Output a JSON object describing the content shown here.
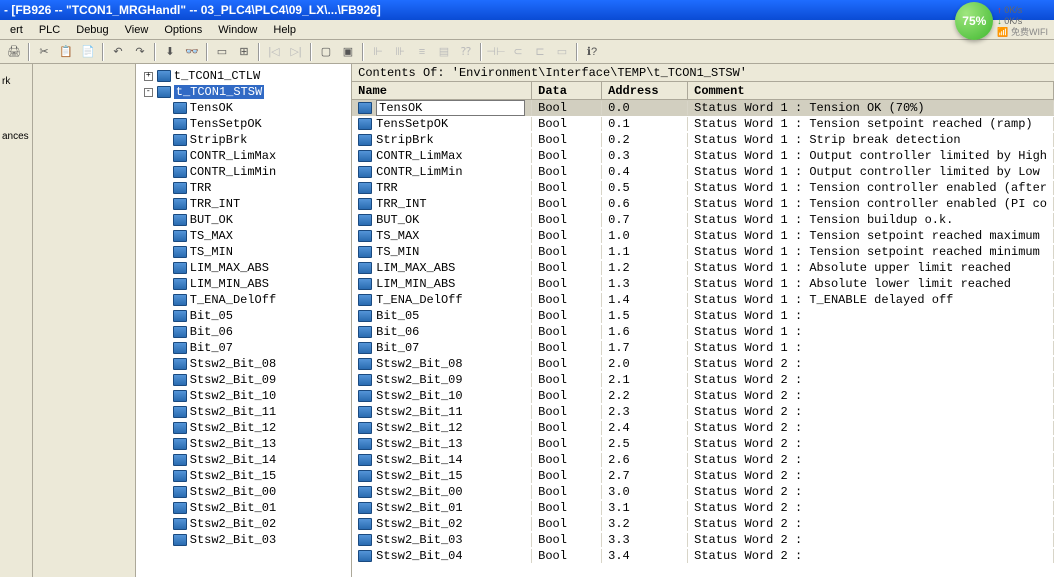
{
  "title": "- [FB926 -- \"TCON1_MRGHandl\" -- 03_PLC4\\PLC4\\09_LX\\...\\FB926]",
  "menu": {
    "items": [
      "ert",
      "PLC",
      "Debug",
      "View",
      "Options",
      "Window",
      "Help"
    ]
  },
  "speed": {
    "pct": "75%",
    "up": "0K/s",
    "down": "0K/s",
    "wifi": "免费WIFI"
  },
  "sidebar": {
    "label1": "rk",
    "label2": "ances"
  },
  "contentsOf": "Contents Of: 'Environment\\Interface\\TEMP\\t_TCON1_STSW'",
  "headers": {
    "name": "Name",
    "type": "Data Type",
    "addr": "Address",
    "comment": "Comment"
  },
  "tree": [
    {
      "label": "t_TCON1_CTLW",
      "indent": 0,
      "box": "+"
    },
    {
      "label": "t_TCON1_STSW",
      "indent": 0,
      "box": "-",
      "sel": true
    },
    {
      "label": "TensOK",
      "indent": 1
    },
    {
      "label": "TensSetpOK",
      "indent": 1
    },
    {
      "label": "StripBrk",
      "indent": 1
    },
    {
      "label": "CONTR_LimMax",
      "indent": 1
    },
    {
      "label": "CONTR_LimMin",
      "indent": 1
    },
    {
      "label": "TRR",
      "indent": 1
    },
    {
      "label": "TRR_INT",
      "indent": 1
    },
    {
      "label": "BUT_OK",
      "indent": 1
    },
    {
      "label": "TS_MAX",
      "indent": 1
    },
    {
      "label": "TS_MIN",
      "indent": 1
    },
    {
      "label": "LIM_MAX_ABS",
      "indent": 1
    },
    {
      "label": "LIM_MIN_ABS",
      "indent": 1
    },
    {
      "label": "T_ENA_DelOff",
      "indent": 1
    },
    {
      "label": "Bit_05",
      "indent": 1
    },
    {
      "label": "Bit_06",
      "indent": 1
    },
    {
      "label": "Bit_07",
      "indent": 1
    },
    {
      "label": "Stsw2_Bit_08",
      "indent": 1
    },
    {
      "label": "Stsw2_Bit_09",
      "indent": 1
    },
    {
      "label": "Stsw2_Bit_10",
      "indent": 1
    },
    {
      "label": "Stsw2_Bit_11",
      "indent": 1
    },
    {
      "label": "Stsw2_Bit_12",
      "indent": 1
    },
    {
      "label": "Stsw2_Bit_13",
      "indent": 1
    },
    {
      "label": "Stsw2_Bit_14",
      "indent": 1
    },
    {
      "label": "Stsw2_Bit_15",
      "indent": 1
    },
    {
      "label": "Stsw2_Bit_00",
      "indent": 1
    },
    {
      "label": "Stsw2_Bit_01",
      "indent": 1
    },
    {
      "label": "Stsw2_Bit_02",
      "indent": 1
    },
    {
      "label": "Stsw2_Bit_03",
      "indent": 1
    }
  ],
  "rows": [
    {
      "name": "TensOK",
      "type": "Bool",
      "addr": "0.0",
      "comment": "Status Word 1 : Tension OK (70%)",
      "sel": true
    },
    {
      "name": "TensSetpOK",
      "type": "Bool",
      "addr": "0.1",
      "comment": "Status Word 1 : Tension setpoint reached (ramp)"
    },
    {
      "name": "StripBrk",
      "type": "Bool",
      "addr": "0.2",
      "comment": "Status Word 1 : Strip break detection"
    },
    {
      "name": "CONTR_LimMax",
      "type": "Bool",
      "addr": "0.3",
      "comment": "Status Word 1 : Output controller limited by High"
    },
    {
      "name": "CONTR_LimMin",
      "type": "Bool",
      "addr": "0.4",
      "comment": "Status Word 1 : Output controller limited by Low"
    },
    {
      "name": "TRR",
      "type": "Bool",
      "addr": "0.5",
      "comment": "Status Word 1 : Tension controller enabled (after"
    },
    {
      "name": "TRR_INT",
      "type": "Bool",
      "addr": "0.6",
      "comment": "Status Word 1 : Tension controller enabled (PI co"
    },
    {
      "name": "BUT_OK",
      "type": "Bool",
      "addr": "0.7",
      "comment": "Status Word 1 : Tension buildup o.k."
    },
    {
      "name": "TS_MAX",
      "type": "Bool",
      "addr": "1.0",
      "comment": "Status Word 1 : Tension setpoint reached maximum"
    },
    {
      "name": "TS_MIN",
      "type": "Bool",
      "addr": "1.1",
      "comment": "Status Word 1 : Tension setpoint reached minimum"
    },
    {
      "name": "LIM_MAX_ABS",
      "type": "Bool",
      "addr": "1.2",
      "comment": "Status Word 1 : Absolute upper limit reached"
    },
    {
      "name": "LIM_MIN_ABS",
      "type": "Bool",
      "addr": "1.3",
      "comment": "Status Word 1 : Absolute lower limit reached"
    },
    {
      "name": "T_ENA_DelOff",
      "type": "Bool",
      "addr": "1.4",
      "comment": "Status Word 1 : T_ENABLE delayed off"
    },
    {
      "name": "Bit_05",
      "type": "Bool",
      "addr": "1.5",
      "comment": "Status Word 1 :"
    },
    {
      "name": "Bit_06",
      "type": "Bool",
      "addr": "1.6",
      "comment": "Status Word 1 :"
    },
    {
      "name": "Bit_07",
      "type": "Bool",
      "addr": "1.7",
      "comment": "Status Word 1 :"
    },
    {
      "name": "Stsw2_Bit_08",
      "type": "Bool",
      "addr": "2.0",
      "comment": "Status Word 2 :"
    },
    {
      "name": "Stsw2_Bit_09",
      "type": "Bool",
      "addr": "2.1",
      "comment": "Status Word 2 :"
    },
    {
      "name": "Stsw2_Bit_10",
      "type": "Bool",
      "addr": "2.2",
      "comment": "Status Word 2 :"
    },
    {
      "name": "Stsw2_Bit_11",
      "type": "Bool",
      "addr": "2.3",
      "comment": "Status Word 2 :"
    },
    {
      "name": "Stsw2_Bit_12",
      "type": "Bool",
      "addr": "2.4",
      "comment": "Status Word 2 :"
    },
    {
      "name": "Stsw2_Bit_13",
      "type": "Bool",
      "addr": "2.5",
      "comment": "Status Word 2 :"
    },
    {
      "name": "Stsw2_Bit_14",
      "type": "Bool",
      "addr": "2.6",
      "comment": "Status Word 2 :"
    },
    {
      "name": "Stsw2_Bit_15",
      "type": "Bool",
      "addr": "2.7",
      "comment": "Status Word 2 :"
    },
    {
      "name": "Stsw2_Bit_00",
      "type": "Bool",
      "addr": "3.0",
      "comment": "Status Word 2 :"
    },
    {
      "name": "Stsw2_Bit_01",
      "type": "Bool",
      "addr": "3.1",
      "comment": "Status Word 2 :"
    },
    {
      "name": "Stsw2_Bit_02",
      "type": "Bool",
      "addr": "3.2",
      "comment": "Status Word 2 :"
    },
    {
      "name": "Stsw2_Bit_03",
      "type": "Bool",
      "addr": "3.3",
      "comment": "Status Word 2 :"
    },
    {
      "name": "Stsw2_Bit_04",
      "type": "Bool",
      "addr": "3.4",
      "comment": "Status Word 2 :"
    }
  ]
}
